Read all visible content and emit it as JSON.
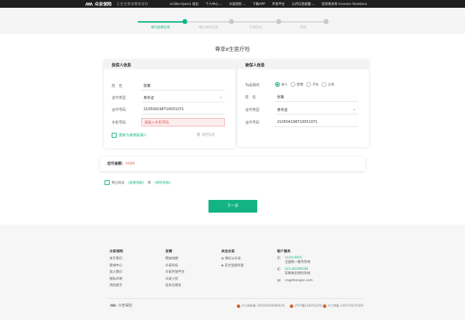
{
  "topbar": {
    "logo_text": "众安保险",
    "slogan": "让生活更温暖更美好",
    "nav": [
      "zs18ecrtjam1 退出",
      "个人中心 ⌄",
      "众安团险 ⌄",
      "下载APP",
      "开发平台",
      "公开信息披露 ⌄",
      "投资者关系 Investor Relations"
    ]
  },
  "steps": [
    "填写投保信息",
    "确认投保信息",
    "在线支付",
    "完成"
  ],
  "page_title": "尊享e生医疗险",
  "applicant": {
    "heading": "投保人信息",
    "name_label": "姓　名",
    "name_value": "张策",
    "id_type_label": "证件类型",
    "id_type_value": "身份证",
    "id_no_label": "证件号码",
    "id_no_value": "210504198710051071",
    "phone_label": "手机号码",
    "phone_placeholder": "请输入手机号码",
    "save_label": "更新为常用投保人",
    "clear_label": "清空信息"
  },
  "insured": {
    "heading": "被保人信息",
    "relation_label": "Ta是我的",
    "relations": [
      "本人",
      "配偶",
      "子女",
      "父母"
    ],
    "name_label": "姓　名",
    "name_value": "张策",
    "id_type_label": "证件类型",
    "id_type_value": "身份证",
    "id_no_label": "证件号码",
    "id_no_value": "210504198710051071"
  },
  "amount": {
    "label": "应付金额:",
    "value": "¥184"
  },
  "agreement": {
    "prefix": "我已阅读",
    "doc1": "《投保须知》",
    "and": "和",
    "doc2": "《保险条款》"
  },
  "next_button": "下一步",
  "footer": {
    "col1": {
      "title": "众安保险",
      "items": [
        "关于我们",
        "新闻中心",
        "加入我们",
        "隐私声明",
        "风险提示"
      ]
    },
    "col2": {
      "title": "友情",
      "items": [
        "网站地图",
        "众安科技",
        "众安开放平台",
        "众安小贷",
        "投诉与建议"
      ]
    },
    "col3": {
      "title": "关注众安",
      "items": [
        "微信公众号",
        "支付宝服务窗"
      ]
    },
    "col4": {
      "title": "客户服务",
      "phone1": "1010-9955",
      "phone1_note": "全国统一服务热线",
      "phone2": "021-80399188",
      "phone2_note": "非税收卖保险热线",
      "email": "cs@zhongan.com"
    },
    "bottom_logo": "众安保险",
    "licenses": [
      "沪公网安备 31010402000662号",
      "沪ICP备13025130号-1",
      "沪工商备 3101370274364"
    ]
  }
}
